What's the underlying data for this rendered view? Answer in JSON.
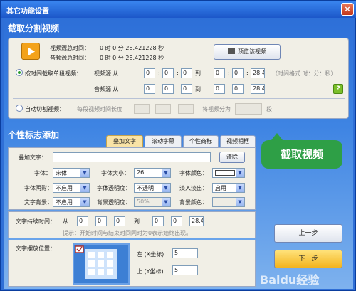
{
  "window": {
    "title": "其它功能设置",
    "close": "×"
  },
  "capture": {
    "section_title": "截取分割视频",
    "video_src_label": "视频源总时间：",
    "video_src_value": "0  时 0  分 28.421228 秒",
    "audio_src_label": "音频源总时间：",
    "audio_src_value": "0  时 0  分 28.421228 秒",
    "preview_button": "预览该视频",
    "by_time_radio": "按时间截取单段视频：",
    "video_row_label": "视频源 从",
    "audio_row_label": "音频源 从",
    "to": "到",
    "sep": ":",
    "zero": "0",
    "end_sec": "28.4",
    "time_format": "（时间格式 时：分：秒）",
    "auto_radio": "自动切割视频：",
    "segment_label": "每段视频时间长度",
    "split_label": "将视频分为",
    "split_unit": "段"
  },
  "logo": {
    "section_title": "个性标志添加",
    "tabs": [
      "叠加文字",
      "滚动字幕",
      "个性商标",
      "视频相框"
    ],
    "overlay_text_label": "叠加文字：",
    "overlay_text_value": "",
    "clear_button": "清除",
    "font_label": "字体：",
    "font_value": "宋体",
    "size_label": "字体大小：",
    "size_value": "26",
    "color_label": "字体颜色：",
    "shadow_label": "字体阴影：",
    "shadow_value": "不启用",
    "opacity_label": "字体透明度：",
    "opacity_value": "不透明",
    "fade_label": "淡入淡出：",
    "fade_value": "启用",
    "bg_label": "文字背景：",
    "bg_value": "不启用",
    "bg_opacity_label": "背景透明度：",
    "bg_opacity_value": "50%",
    "bg_color_label": "背景颜色：",
    "duration_label": "文字持续时间：",
    "from": "从",
    "to": "到",
    "zero": "0",
    "end": "28.4",
    "hint": "提示：开始时间与结束时间同时为0表示始终出现。",
    "position_label": "文字摆放位置：",
    "left_label": "左 (X坐标)",
    "left_value": "5",
    "top_label": "上 (Y坐标)",
    "top_value": "5"
  },
  "buttons": {
    "prev": "上一步",
    "next": "下一步"
  },
  "annotation": {
    "callout": "截取视频",
    "watermark": "Baidu经验"
  },
  "colors": {
    "accent": "#2e9f46",
    "title_bar": "#1c57c9"
  }
}
